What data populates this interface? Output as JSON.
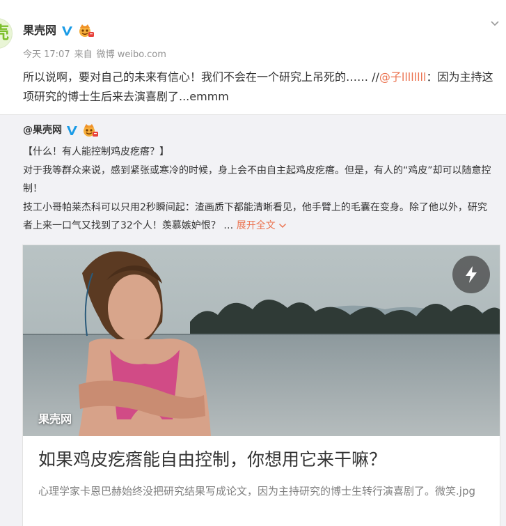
{
  "post": {
    "author": "果壳网",
    "avatar_glyph": "壳",
    "time": "今天 17:07",
    "source_prefix": "来自",
    "source": "微博 weibo.com",
    "text_before_mention": "所以说啊，要对自己的未来有信心！我们不会在一个研究上吊死的…… //",
    "mention": "@子llllllll",
    "text_after_mention": "：因为主持这项研究的博士生后来去演喜剧了...emmm"
  },
  "repost": {
    "author": "@果壳网",
    "lines": [
      "【什么！有人能控制鸡皮疙瘩？】",
      "对于我等群众来说，感到紧张或寒冷的时候，身上会不由自主起鸡皮疙瘩。但是，有人的“鸡皮”却可以随意控制！",
      "技工小哥帕莱杰科可以只用2秒瞬间起：渣画质下都能清晰看见，他手臂上的毛囊在变身。除了他以外，研究者上来一口气又找到了32个人！羡慕嫉妒恨？ … "
    ],
    "expand_label": "展开全文",
    "expand_icon": "chevron-down-icon"
  },
  "card": {
    "watermark": "果壳网",
    "title": "如果鸡皮疙瘩能自由控制，你想用它来干嘛？",
    "description": "心理学家卡恩巴赫始终没把研究结果写成论文，因为主持研究的博士生转行演喜剧了。微笑.jpg",
    "play_icon": "lightning-icon"
  },
  "colors": {
    "accent": "#eb7350",
    "verified_blue": "#1a9be6",
    "vip_orange": "#f6ae3a",
    "muted": "#939393",
    "repost_bg": "#f2f2f5"
  }
}
